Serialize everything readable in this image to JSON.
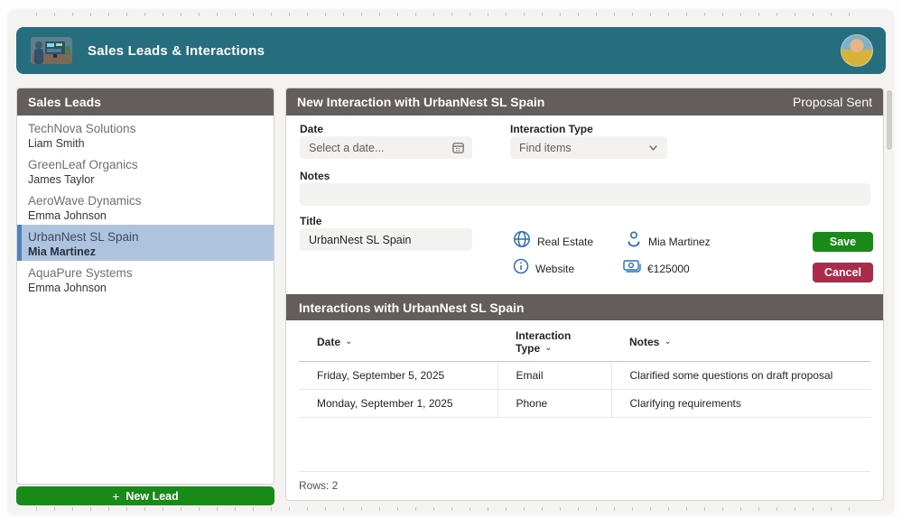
{
  "app": {
    "title": "Sales Leads & Interactions"
  },
  "sidebar": {
    "header": "Sales Leads",
    "leads": [
      {
        "company": "TechNova Solutions",
        "contact": "Liam Smith",
        "selected": false
      },
      {
        "company": "GreenLeaf Organics",
        "contact": "James Taylor",
        "selected": false
      },
      {
        "company": "AeroWave Dynamics",
        "contact": "Emma Johnson",
        "selected": false
      },
      {
        "company": "UrbanNest SL Spain",
        "contact": "Mia Martinez",
        "selected": true
      },
      {
        "company": "AquaPure Systems",
        "contact": "Emma Johnson",
        "selected": false
      }
    ],
    "new_lead_plus": "+",
    "new_lead_label": "New Lead"
  },
  "form": {
    "header": "New Interaction with UrbanNest SL Spain",
    "status": "Proposal Sent",
    "fields": {
      "date": {
        "label": "Date",
        "placeholder": "Select a date...",
        "icon": "calendar-icon"
      },
      "interaction_type": {
        "label": "Interaction Type",
        "placeholder": "Find items",
        "icon": "chevron-down-icon"
      },
      "notes": {
        "label": "Notes",
        "value": ""
      },
      "title": {
        "label": "Title",
        "value": "UrbanNest SL Spain"
      }
    },
    "details": [
      {
        "icon": "globe-icon",
        "label": "Real Estate"
      },
      {
        "icon": "person-icon",
        "label": "Mia Martinez"
      },
      {
        "icon": "info-icon",
        "label": "Website"
      },
      {
        "icon": "money-icon",
        "label": "€125000"
      }
    ],
    "save_label": "Save",
    "cancel_label": "Cancel"
  },
  "interactions": {
    "header": "Interactions with UrbanNest SL Spain",
    "table": {
      "columns": [
        "Date",
        "Interaction Type",
        "Notes"
      ],
      "rows": [
        [
          "Friday, September 5, 2025",
          "Email",
          "Clarified some questions on draft proposal"
        ],
        [
          "Monday, September 1, 2025",
          "Phone",
          "Clarifying requirements"
        ]
      ]
    },
    "row_count_label": "Rows: 2"
  },
  "colors": {
    "teal": "#266e7e",
    "panel-header": "#635d5b",
    "selected-blue": "#aec4de",
    "selected-border": "#4f81bd",
    "green": "#188a18",
    "red": "#ab2b4a",
    "icon-blue": "#2d6fb8"
  }
}
